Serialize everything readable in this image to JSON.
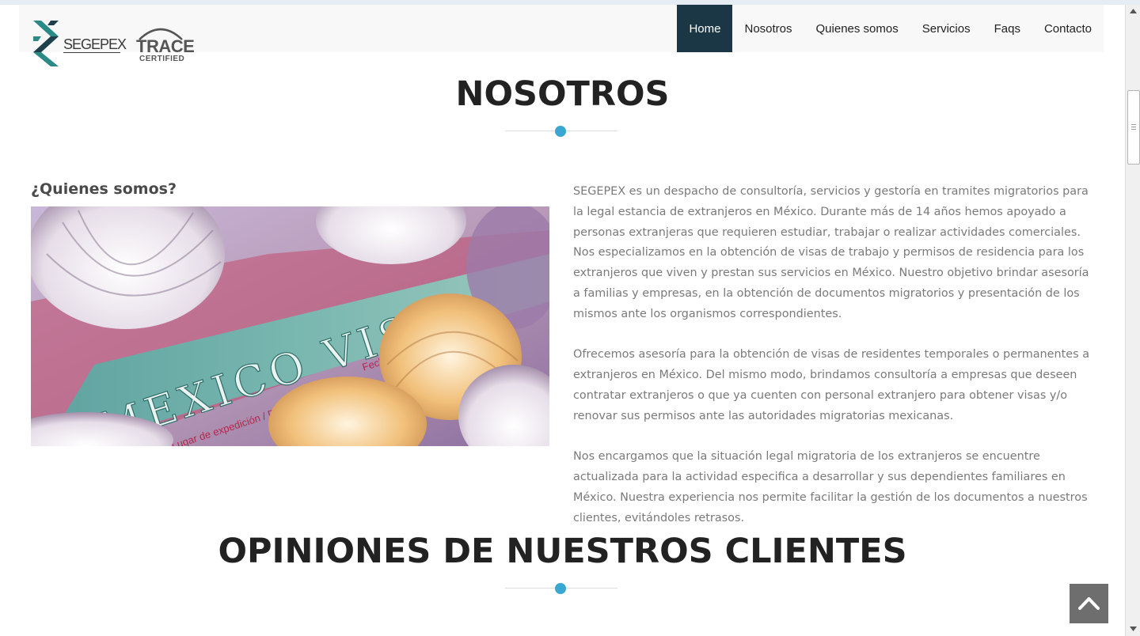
{
  "brand": {
    "logo_text": "SEGEPEX",
    "badge_word": "TRACE",
    "badge_sub": "CERTIFIED"
  },
  "nav": {
    "items": [
      {
        "label": "Home",
        "active": true
      },
      {
        "label": "Nosotros",
        "active": false
      },
      {
        "label": "Quienes somos",
        "active": false
      },
      {
        "label": "Servicios",
        "active": false
      },
      {
        "label": "Faqs",
        "active": false
      },
      {
        "label": "Contacto",
        "active": false
      }
    ]
  },
  "about": {
    "title": "NOSOTROS",
    "subtitle": "¿Quienes somos?",
    "image_caption_text": "MEXICO VISA",
    "image_small_text_1": "Lugar de expedición / Place of issue",
    "image_small_text_2": "Fecha",
    "paragraphs": [
      "SEGEPEX es un despacho de consultoría, servicios y gestoría en tramites migratorios para la legal estancia de extranjeros en México. Durante más de 14 años hemos  apoyado a personas extranjeras que requieren estudiar, trabajar o realizar actividades comerciales. Nos especializamos en la obtención de visas de trabajo y permisos de residencia para los extranjeros que viven y prestan sus servicios en México.  Nuestro objetivo brindar asesoría a familias y empresas, en la obtención de documentos migratorios y presentación de los mismos ante los organismos correspondientes.",
      "Ofrecemos asesoría para la obtención de visas de residentes temporales o permanentes a extranjeros en México. Del mismo modo,  brindamos consultoría a empresas que deseen contratar extranjeros o que ya cuenten con personal extranjero para obtener visas y/o renovar sus permisos ante las autoridades migratorias mexicanas.",
      "Nos encargamos que la situación legal migratoria de los extranjeros se encuentre actualizada para la actividad especifica a desarrollar y sus dependientes familiares en México. Nuestra experiencia nos permite facilitar la gestión de los documentos a nuestros clientes, evitándoles retrasos."
    ]
  },
  "testimonials": {
    "title": "OPINIONES DE NUESTROS CLIENTES"
  },
  "colors": {
    "nav_active": "#1b3745",
    "accent_dot": "#3aa7d2",
    "logo_teal": "#2a8a86",
    "to_top_bg": "#6e6e6e"
  },
  "icons": {
    "to_top": "chevron-up-icon",
    "scroll_up": "triangle-up-icon",
    "scroll_down": "triangle-down-icon"
  }
}
